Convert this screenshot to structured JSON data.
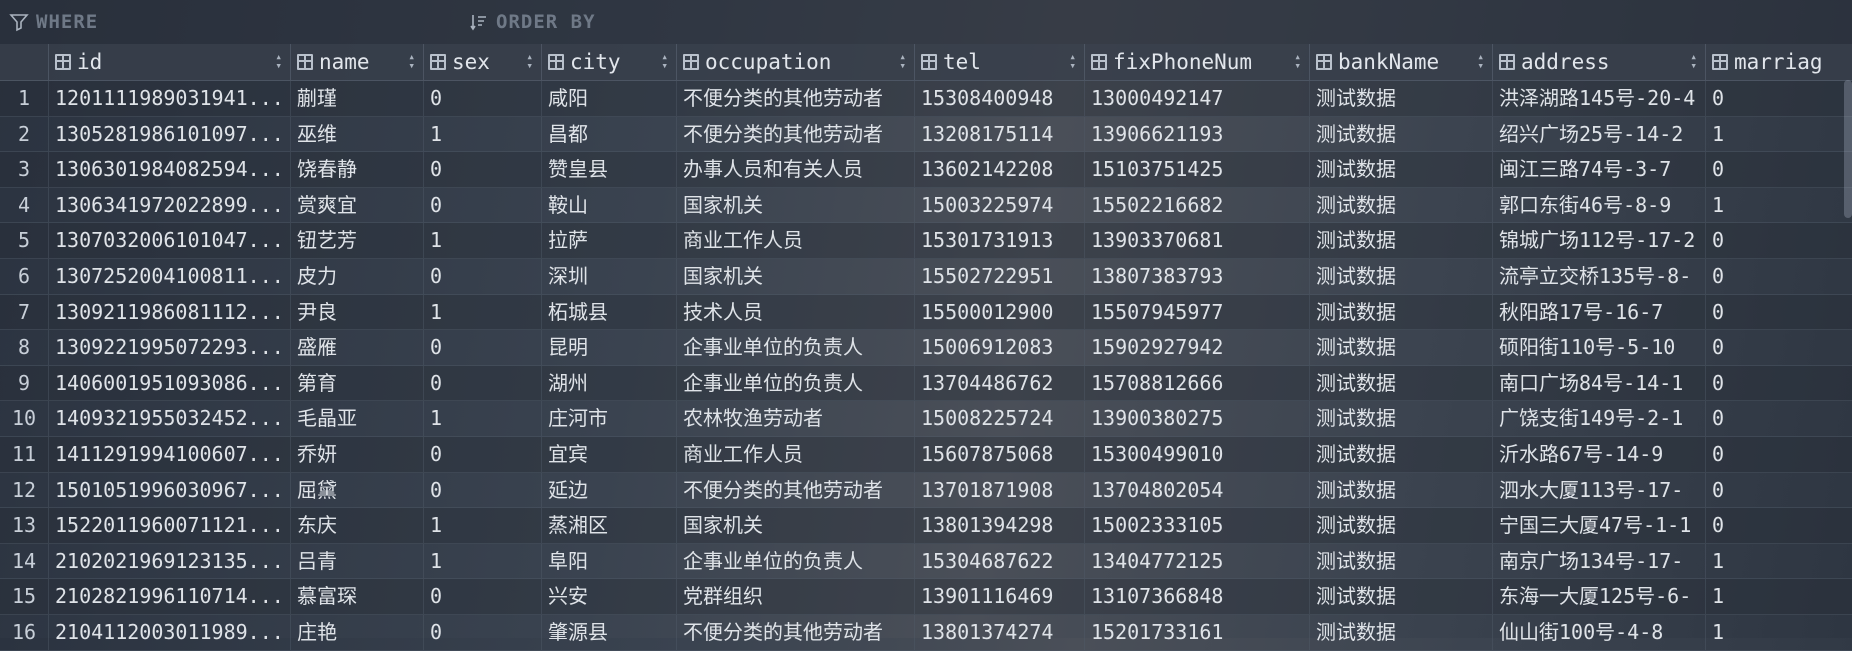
{
  "filter": {
    "where_label": "WHERE",
    "order_label": "ORDER BY"
  },
  "columns": [
    "id",
    "name",
    "sex",
    "city",
    "occupation",
    "tel",
    "fixPhoneNum",
    "bankName",
    "address",
    "marriag"
  ],
  "rows": [
    {
      "n": "1",
      "id": "120111198903194​1...",
      "name": "蒯瑾",
      "sex": "0",
      "city": "咸阳",
      "occupation": "不便分类的其他劳动者",
      "tel": "15308400948",
      "fix": "13000492147",
      "bank": "测试数据",
      "addr": "洪泽湖路145号-20-4",
      "mar": "0"
    },
    {
      "n": "2",
      "id": "1305281986101097...",
      "name": "巫维",
      "sex": "1",
      "city": "昌都",
      "occupation": "不便分类的其他劳动者",
      "tel": "13208175114",
      "fix": "13906621193",
      "bank": "测试数据",
      "addr": "绍兴广场25号-14-2",
      "mar": "1"
    },
    {
      "n": "3",
      "id": "1306301984082594...",
      "name": "饶春静",
      "sex": "0",
      "city": "赞皇县",
      "occupation": "办事人员和有关人员",
      "tel": "13602142208",
      "fix": "15103751425",
      "bank": "测试数据",
      "addr": "闽江三路74号-3-7",
      "mar": "0"
    },
    {
      "n": "4",
      "id": "1306341972022899...",
      "name": "赏爽宜",
      "sex": "0",
      "city": "鞍山",
      "occupation": "国家机关",
      "tel": "15003225974",
      "fix": "15502216682",
      "bank": "测试数据",
      "addr": "郭口东街46号-8-9",
      "mar": "1"
    },
    {
      "n": "5",
      "id": "1307032006101047...",
      "name": "钮艺芳",
      "sex": "1",
      "city": "拉萨",
      "occupation": "商业工作人员",
      "tel": "15301731913",
      "fix": "13903370681",
      "bank": "测试数据",
      "addr": "锦城广场112号-17-2",
      "mar": "0"
    },
    {
      "n": "6",
      "id": "1307252004100811...",
      "name": "皮力",
      "sex": "0",
      "city": "深圳",
      "occupation": "国家机关",
      "tel": "15502722951",
      "fix": "13807383793",
      "bank": "测试数据",
      "addr": "流亭立交桥135号-8-",
      "mar": "0"
    },
    {
      "n": "7",
      "id": "1309211986081112...",
      "name": "尹良",
      "sex": "1",
      "city": "柘城县",
      "occupation": "技术人员",
      "tel": "15500012900",
      "fix": "15507945977",
      "bank": "测试数据",
      "addr": "秋阳路17号-16-7",
      "mar": "0"
    },
    {
      "n": "8",
      "id": "1309221995072293...",
      "name": "盛雁",
      "sex": "0",
      "city": "昆明",
      "occupation": "企事业单位的负责人",
      "tel": "15006912083",
      "fix": "15902927942",
      "bank": "测试数据",
      "addr": "硕阳街110号-5-10",
      "mar": "0"
    },
    {
      "n": "9",
      "id": "1406001951093086...",
      "name": "第育",
      "sex": "0",
      "city": "湖州",
      "occupation": "企事业单位的负责人",
      "tel": "13704486762",
      "fix": "15708812666",
      "bank": "测试数据",
      "addr": "南口广场84号-14-1",
      "mar": "0"
    },
    {
      "n": "10",
      "id": "1409321955032452...",
      "name": "毛晶亚",
      "sex": "1",
      "city": "庄河市",
      "occupation": "农林牧渔劳动者",
      "tel": "15008225724",
      "fix": "13900380275",
      "bank": "测试数据",
      "addr": "广饶支街149号-2-1",
      "mar": "0"
    },
    {
      "n": "11",
      "id": "1411291994100607...",
      "name": "乔妍",
      "sex": "0",
      "city": "宜宾",
      "occupation": "商业工作人员",
      "tel": "15607875068",
      "fix": "15300499010",
      "bank": "测试数据",
      "addr": "沂水路67号-14-9",
      "mar": "0"
    },
    {
      "n": "12",
      "id": "1501051996030967...",
      "name": "屈黛",
      "sex": "0",
      "city": "延边",
      "occupation": "不便分类的其他劳动者",
      "tel": "13701871908",
      "fix": "13704802054",
      "bank": "测试数据",
      "addr": "泗水大厦113号-17-",
      "mar": "0"
    },
    {
      "n": "13",
      "id": "1522011960071121...",
      "name": "东庆",
      "sex": "1",
      "city": "蒸湘区",
      "occupation": "国家机关",
      "tel": "13801394298",
      "fix": "15002333105",
      "bank": "测试数据",
      "addr": "宁国三大厦47号-1-1",
      "mar": "0"
    },
    {
      "n": "14",
      "id": "2102021969123135...",
      "name": "吕青",
      "sex": "1",
      "city": "阜阳",
      "occupation": "企事业单位的负责人",
      "tel": "15304687622",
      "fix": "13404772125",
      "bank": "测试数据",
      "addr": "南京广场134号-17-",
      "mar": "1"
    },
    {
      "n": "15",
      "id": "2102821996110714...",
      "name": "慕富琛",
      "sex": "0",
      "city": "兴安",
      "occupation": "党群组织",
      "tel": "13901116469",
      "fix": "13107366848",
      "bank": "测试数据",
      "addr": "东海一大厦125号-6-",
      "mar": "1"
    },
    {
      "n": "16",
      "id": "2104112003011989...",
      "name": "庄艳",
      "sex": "0",
      "city": "肇源县",
      "occupation": "不便分类的其他劳动者",
      "tel": "13801374274",
      "fix": "15201733161",
      "bank": "测试数据",
      "addr": "仙山街100号-4-8",
      "mar": "1"
    }
  ]
}
